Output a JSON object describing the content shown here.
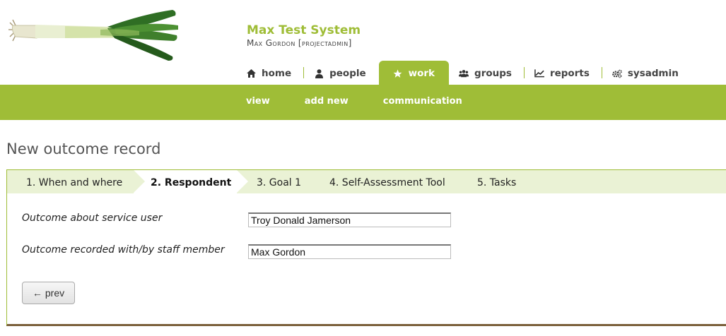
{
  "header": {
    "system_title": "Max Test System",
    "user_line": "Max Gordon [projectadmin]",
    "logo_icon": "leek-logo"
  },
  "main_nav": {
    "items": [
      {
        "label": "home",
        "icon": "home-icon"
      },
      {
        "label": "people",
        "icon": "person-icon"
      },
      {
        "label": "work",
        "icon": "star-icon",
        "active": true
      },
      {
        "label": "groups",
        "icon": "group-icon"
      },
      {
        "label": "reports",
        "icon": "chart-line-icon"
      },
      {
        "label": "sysadmin",
        "icon": "gears-icon"
      }
    ]
  },
  "sub_nav": {
    "items": [
      "view",
      "add new",
      "communication"
    ]
  },
  "page": {
    "title": "New outcome record"
  },
  "steps": [
    {
      "label": "1. When and where"
    },
    {
      "label": "2. Respondent",
      "active": true
    },
    {
      "label": "3. Goal 1"
    },
    {
      "label": "4. Self-Assessment Tool"
    },
    {
      "label": "5. Tasks"
    }
  ],
  "form": {
    "service_user_label": "Outcome about service user",
    "service_user_value": "Troy Donald Jamerson",
    "staff_label": "Outcome recorded with/by staff member",
    "staff_value": "Max Gordon",
    "prev_label": "prev"
  },
  "colors": {
    "accent": "#9fbd37",
    "step_bar": "#eaf2d5",
    "panel_bottom": "#7a5f3a"
  }
}
